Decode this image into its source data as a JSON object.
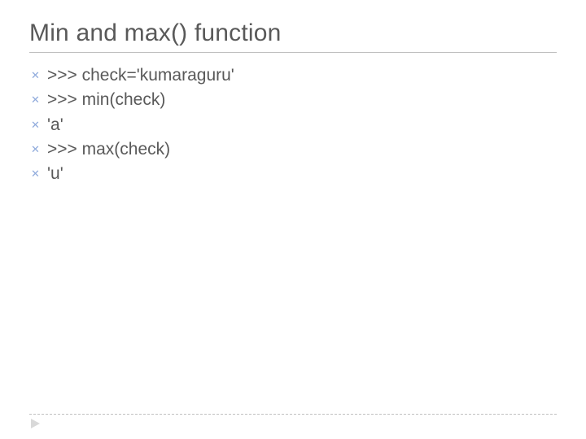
{
  "slide": {
    "title": "Min and max() function",
    "bullets": [
      {
        "glyph": "✕",
        "text": ">>> check='kumaraguru'"
      },
      {
        "glyph": "✕",
        "text": ">>> min(check)"
      },
      {
        "glyph": "✕",
        "text": "'a'"
      },
      {
        "glyph": "✕",
        "text": ">>> max(check)"
      },
      {
        "glyph": "✕",
        "text": "'u'"
      }
    ]
  }
}
